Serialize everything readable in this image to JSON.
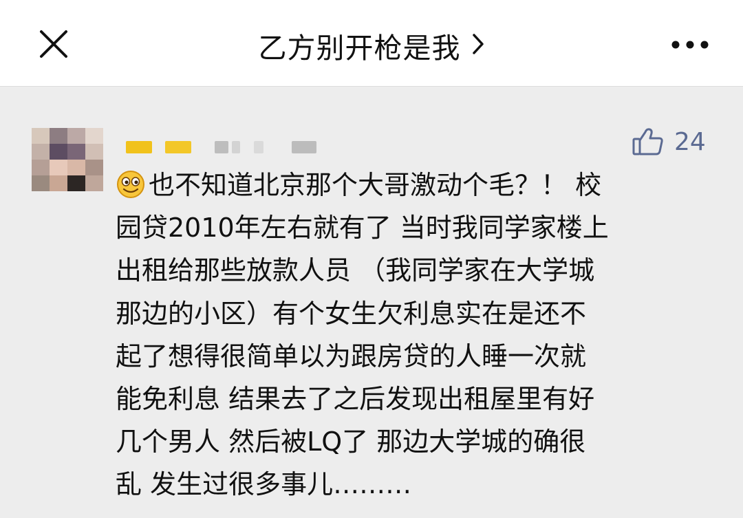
{
  "header": {
    "title": "乙方别开枪是我",
    "close_icon": "close-icon",
    "chevron_icon": "chevron-right-icon",
    "more_icon": "more-options-icon"
  },
  "comment": {
    "avatar_icon": "blurred-avatar",
    "username_icon": "blurred-username",
    "likes": "24",
    "like_icon": "thumbs-up-icon",
    "emoji_icon": "smiley-face-emoji",
    "lines": [
      "也不知道北京那个大哥激动个毛？！ 校",
      "园贷2010年左右就有了 当时我同学家楼上",
      "出租给那些放款人员 （我同学家在大学城",
      "那边的小区）有个女生欠利息实在是还不",
      "起了想得很简单以为跟房贷的人睡一次就",
      "能免利息 结果去了之后发现出租屋里有好",
      "几个男人 然后被LQ了 那边大学城的确很",
      "乱 发生过很多事儿………"
    ]
  },
  "colors": {
    "background": "#ededed",
    "header_bg": "#ffffff",
    "like_color": "#5b6a92",
    "username_highlight": "#f1c21b"
  }
}
